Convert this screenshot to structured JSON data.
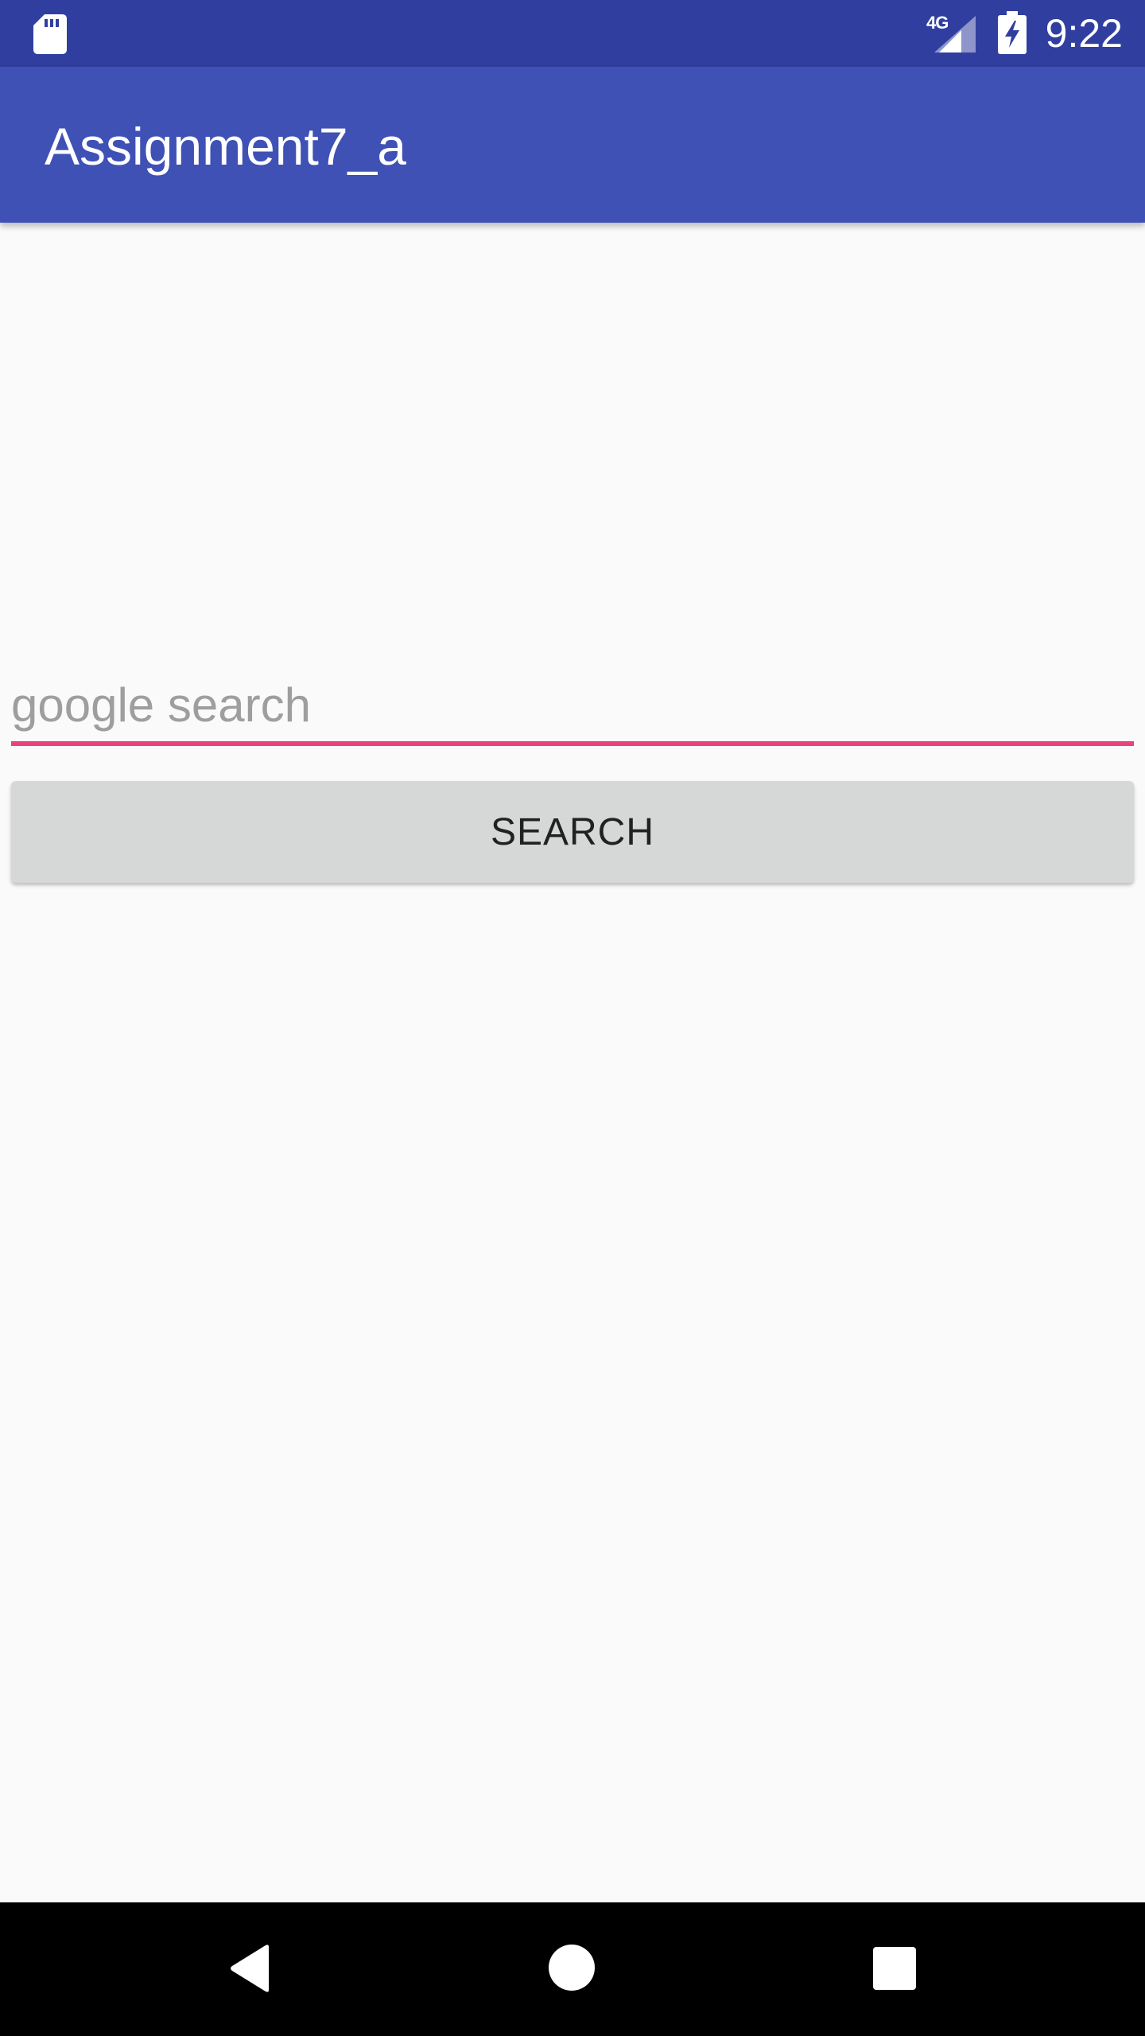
{
  "status_bar": {
    "time": "9:22",
    "network": "4G",
    "icons": [
      "sd-card-icon",
      "signal-icon",
      "battery-charging-icon"
    ],
    "color": "#303f9f"
  },
  "app_bar": {
    "title": "Assignment7_a",
    "color": "#3f51b5"
  },
  "search": {
    "placeholder": "google search",
    "value": "",
    "underline_color": "#e8437c"
  },
  "search_button": {
    "label": "SEARCH"
  },
  "nav_bar": {
    "icons": [
      "back-icon",
      "home-icon",
      "recents-icon"
    ]
  }
}
